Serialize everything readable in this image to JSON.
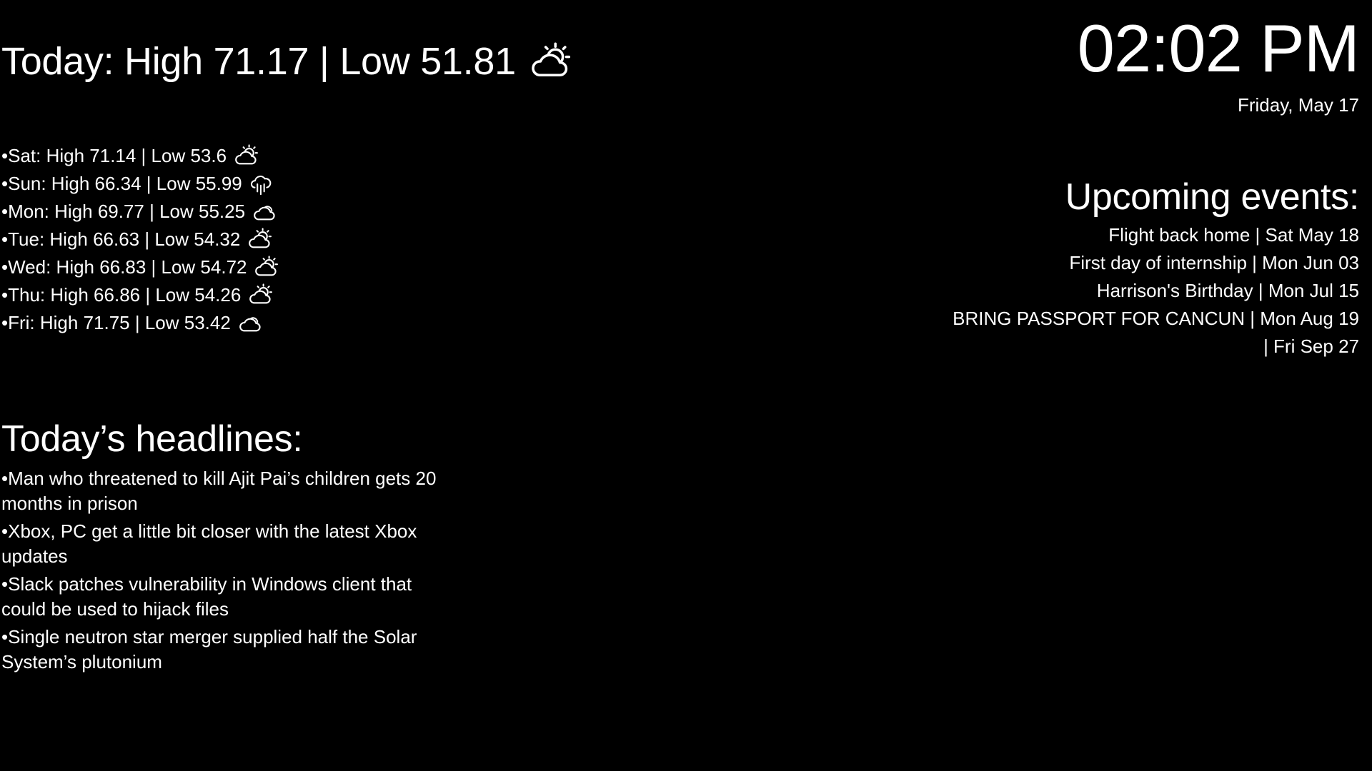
{
  "weather": {
    "today": {
      "text": "Today: High 71.17 | Low 51.81",
      "icon": "partly-cloudy-day-icon"
    },
    "forecast": [
      {
        "text": "•Sat: High 71.14 | Low 53.6",
        "icon": "partly-cloudy-day-icon"
      },
      {
        "text": "•Sun: High 66.34 | Low 55.99",
        "icon": "rain-cloud-icon"
      },
      {
        "text": "•Mon: High 69.77 | Low 55.25",
        "icon": "cloudy-icon"
      },
      {
        "text": "•Tue: High 66.63 | Low 54.32",
        "icon": "partly-cloudy-day-icon"
      },
      {
        "text": "•Wed: High 66.83 | Low 54.72",
        "icon": "partly-cloudy-day-icon"
      },
      {
        "text": "•Thu: High 66.86 | Low 54.26",
        "icon": "partly-cloudy-day-icon"
      },
      {
        "text": "•Fri: High 71.75 | Low 53.42",
        "icon": "cloudy-icon"
      }
    ]
  },
  "headlines": {
    "title": "Today’s headlines:",
    "items": [
      "•Man who threatened to kill Ajit Pai’s children gets 20 months in prison",
      "•Xbox, PC get a little bit closer with the latest Xbox updates",
      "•Slack patches vulnerability in Windows client that could be used to hijack files",
      "•Single neutron star merger supplied half the Solar System’s plutonium"
    ]
  },
  "clock": {
    "time": "02:02 PM",
    "date": "Friday, May 17"
  },
  "events": {
    "title": "Upcoming events:",
    "items": [
      "Flight back home | Sat May 18",
      "First day of internship | Mon Jun 03",
      "Harrison's Birthday | Mon Jul 15",
      "BRING PASSPORT FOR CANCUN | Mon Aug 19",
      " | Fri Sep 27"
    ]
  },
  "colors": {
    "background": "#000000",
    "foreground": "#ffffff"
  }
}
